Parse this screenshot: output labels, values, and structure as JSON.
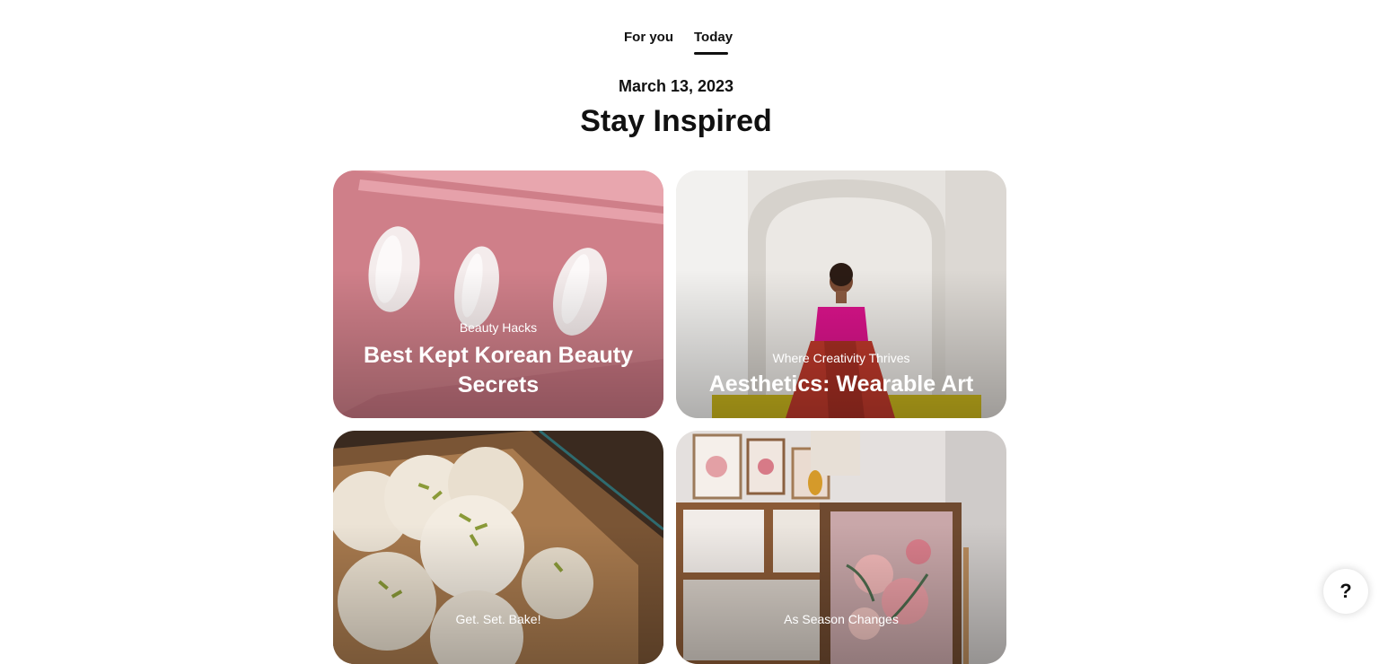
{
  "tabs": [
    {
      "label": "For you",
      "active": false
    },
    {
      "label": "Today",
      "active": true
    }
  ],
  "date": "March 13, 2023",
  "headline": "Stay Inspired",
  "cards": [
    {
      "kicker": "Beauty Hacks",
      "title": "Best Kept Korean Beauty Secrets",
      "color": "#e79aa3"
    },
    {
      "kicker": "Where Creativity Thrives",
      "title": "Aesthetics: Wearable Art",
      "color": "#e9e6e3"
    },
    {
      "kicker": "Get. Set. Bake!",
      "title": "",
      "color": "#6b4a33"
    },
    {
      "kicker": "As Season Changes",
      "title": "",
      "color": "#cfc5be"
    }
  ],
  "help": {
    "label": "?",
    "icon": "help-icon"
  }
}
